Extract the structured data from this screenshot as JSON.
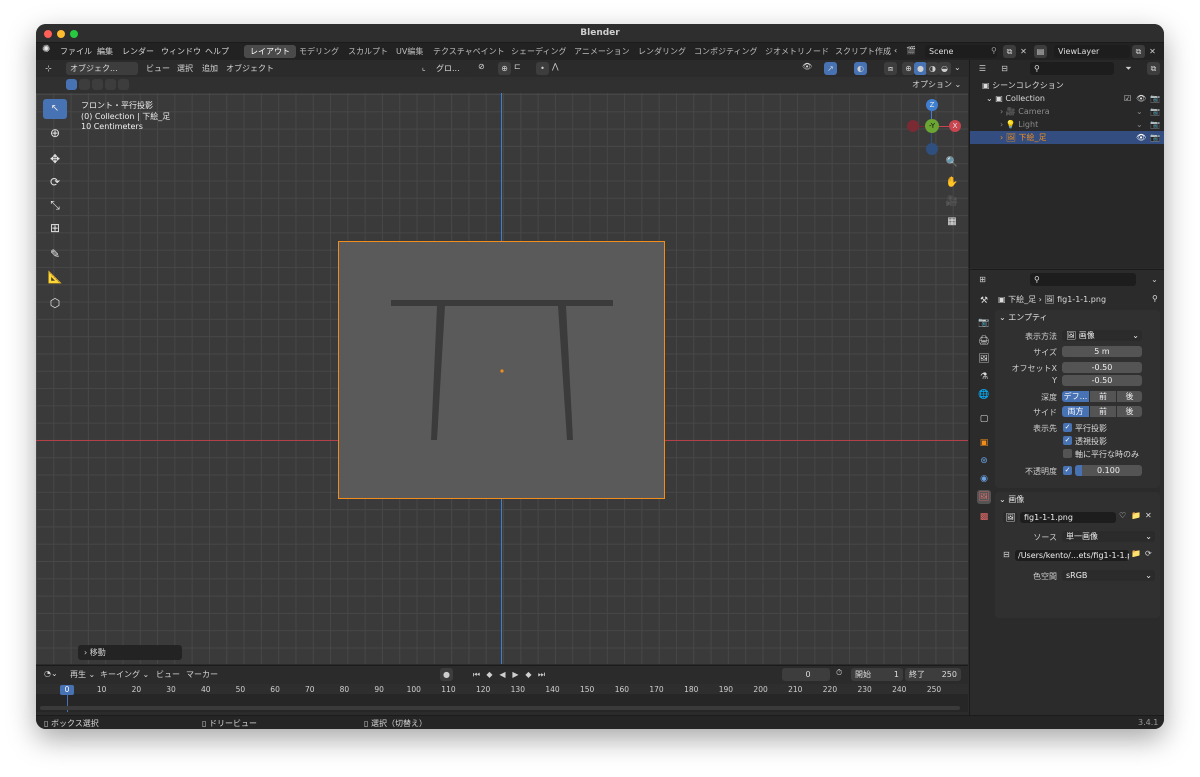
{
  "window": {
    "title": "Blender",
    "version": "3.4.1"
  },
  "menus": [
    "ファイル",
    "編集",
    "レンダー",
    "ウィンドウ",
    "ヘルプ"
  ],
  "workspaces": [
    "レイアウト",
    "モデリング",
    "スカルプト",
    "UV編集",
    "テクスチャペイント",
    "シェーディング",
    "アニメーション",
    "レンダリング",
    "コンポジティング",
    "ジオメトリノード",
    "スクリプト作成"
  ],
  "active_workspace": "レイアウト",
  "scene": {
    "name": "Scene"
  },
  "view_layer": {
    "name": "ViewLayer"
  },
  "viewport_header": {
    "mode": "オブジェク...",
    "menus": [
      "ビュー",
      "選択",
      "追加",
      "オブジェクト"
    ],
    "transform_orientation": "グロ...",
    "options_label": "オプション"
  },
  "viewport_info": {
    "line1": "フロント・平行投影",
    "line2": "(0) Collection | 下絵_足",
    "line3": "10 Centimeters"
  },
  "gizmo": {
    "z": "Z",
    "y": "-Y",
    "x": "X"
  },
  "last_operator": "移動",
  "outliner": {
    "title": "シーンコレクション",
    "items": [
      {
        "label": "Collection"
      },
      {
        "label": "Camera"
      },
      {
        "label": "Light"
      },
      {
        "label": "下絵_足"
      }
    ]
  },
  "properties": {
    "breadcrumb": {
      "object": "下絵_足",
      "data": "fig1-1-1.png"
    },
    "empty_panel": {
      "title": "エンプティ",
      "display_as_label": "表示方法",
      "display_as_value": "画像",
      "size_label": "サイズ",
      "size_value": "5 m",
      "offset_x_label": "オフセットX",
      "offset_x_value": "-0.50",
      "offset_y_label": "Y",
      "offset_y_value": "-0.50",
      "depth_label": "深度",
      "depth_options": [
        "デフ...",
        "前",
        "後"
      ],
      "side_label": "サイド",
      "side_options": [
        "両方",
        "前",
        "後"
      ],
      "show_in_label": "表示先",
      "show_orthographic": "平行投影",
      "show_perspective": "透視投影",
      "only_axis_aligned": "軸に平行な時のみ",
      "opacity_label": "不透明度",
      "opacity_value": "0.100",
      "opacity_fraction": 0.1
    },
    "image_panel": {
      "title": "画像",
      "image_name": "fig1-1-1.png",
      "source_label": "ソース",
      "source_value": "単一画像",
      "filepath": "/Users/kento/...ets/fig1-1-1.png",
      "colorspace_label": "色空間",
      "colorspace_value": "sRGB"
    }
  },
  "timeline": {
    "menus": [
      "再生",
      "キーイング",
      "ビュー",
      "マーカー"
    ],
    "current_frame": "0",
    "start_label": "開始",
    "start_value": "1",
    "end_label": "終了",
    "end_value": "250",
    "playhead": "0",
    "ticks": [
      "10",
      "20",
      "30",
      "40",
      "50",
      "60",
      "70",
      "80",
      "90",
      "100",
      "110",
      "120",
      "130",
      "140",
      "150",
      "160",
      "170",
      "180",
      "190",
      "200",
      "210",
      "220",
      "230",
      "240",
      "250"
    ]
  },
  "statusbar": {
    "hint1": "ボックス選択",
    "hint2": "ドリービュー",
    "hint3": "選択（切替え）"
  },
  "colors": {
    "accent": "#4772b3",
    "selection_orange": "#f08d1c",
    "x_axis": "#c8444f",
    "y_axis": "#6ba534",
    "z_axis": "#3f7fd1"
  }
}
